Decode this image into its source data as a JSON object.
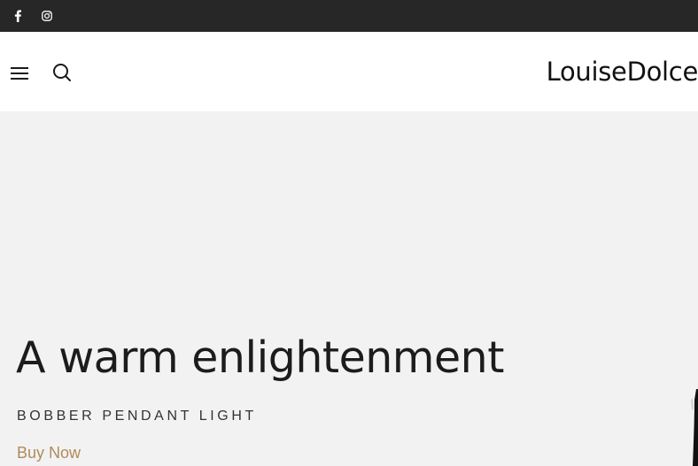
{
  "topbar": {
    "social": [
      {
        "icon": "facebook-icon"
      },
      {
        "icon": "instagram-icon"
      }
    ]
  },
  "header": {
    "logo_text": "LouiseDolce",
    "menu_icon": "hamburger-menu-icon",
    "search_icon": "search-icon"
  },
  "hero": {
    "title": "A warm enlightenment",
    "subtitle": "BOBBER PENDANT LIGHT",
    "cta_label": "Buy Now"
  },
  "colors": {
    "topbar_bg": "#272727",
    "header_bg": "#ffffff",
    "hero_bg": "#f2f2f2",
    "cta": "#b08b5b",
    "text": "#1c1c1c"
  }
}
